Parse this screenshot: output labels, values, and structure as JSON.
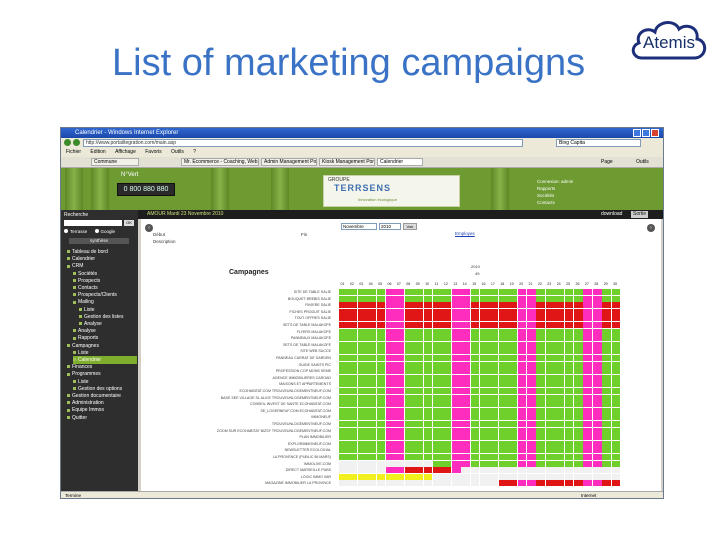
{
  "slide_title": "List of marketing campaigns",
  "logo_text": "Atemis",
  "browser": {
    "window_title": "Calendrier - Windows Internet Explorer",
    "url": "http://www.portailtegration.com/main.asp",
    "search_text": "Bing Capita",
    "menu": [
      "Fichier",
      "Edition",
      "Affichage",
      "Favoris",
      "Outils",
      "?"
    ],
    "tabs": [
      "Commune",
      "Mr. Ecommerce - Coaching, Web...",
      "Admin Management Portal",
      "Kiosk Management Portal",
      "Calendrier"
    ],
    "right_menu": [
      "Page",
      "Outils"
    ],
    "status_left": "Termine",
    "status_right": "Internet"
  },
  "app": {
    "nvert": "N°Vert",
    "phone": "0 800 880 880",
    "brand_groupe": "GROUPE",
    "brand_name": "TERRSENS",
    "brand_tagline": "Innovation écologique",
    "header_info": "Connexion: admin\nRapports\nSociétés\nContacts",
    "user_bar": "AMOUR  Mardi 23 Novembre 2010",
    "download_label": "download",
    "exit_label": "Sortie"
  },
  "sidebar": {
    "search_title": "Recherche",
    "go_label": "OK",
    "radio_labels": [
      "Terrasse",
      "Google"
    ],
    "select_value": "synthèse",
    "items": [
      {
        "label": "Tableau de bord",
        "level": 0
      },
      {
        "label": "Calendrier",
        "level": 0
      },
      {
        "label": "CRM",
        "level": 0
      },
      {
        "label": "Sociétés",
        "level": 1
      },
      {
        "label": "Prospects",
        "level": 1
      },
      {
        "label": "Contacts",
        "level": 1
      },
      {
        "label": "Prospects/Clients",
        "level": 1
      },
      {
        "label": "Mailing",
        "level": 1
      },
      {
        "label": "Liste",
        "level": 2
      },
      {
        "label": "Gestion des listes",
        "level": 2
      },
      {
        "label": "Analyse",
        "level": 2
      },
      {
        "label": "Analyse",
        "level": 1
      },
      {
        "label": "Rapports",
        "level": 1
      },
      {
        "label": "Campagnes",
        "level": 0
      },
      {
        "label": "Liste",
        "level": 1
      },
      {
        "label": "Calendrier",
        "level": 1,
        "active": true
      },
      {
        "label": "Finances",
        "level": 0
      },
      {
        "label": "Programmes",
        "level": 0
      },
      {
        "label": "Liste",
        "level": 1
      },
      {
        "label": "Gestion des options",
        "level": 1
      },
      {
        "label": "Gestion documentaire",
        "level": 0
      },
      {
        "label": "Administration",
        "level": 0
      },
      {
        "label": "Equipe Immos",
        "level": 0
      },
      {
        "label": "Quitter",
        "level": 0
      }
    ]
  },
  "content": {
    "debut_label": "Début",
    "fin_label": "Fin",
    "description_label": "Description",
    "month_select": "Novembre",
    "year_select": "2010",
    "valid_label": "Voir",
    "link_label": "Employes",
    "campaigns_title": "Campagnes",
    "year_label": "2010",
    "week_label": "49",
    "days": [
      "01",
      "02",
      "03",
      "04",
      "05",
      "06",
      "07",
      "08",
      "09",
      "10",
      "11",
      "12",
      "13",
      "14",
      "15",
      "16",
      "17",
      "18",
      "19",
      "20",
      "21",
      "22",
      "23",
      "24",
      "25",
      "26",
      "27",
      "28",
      "29",
      "30"
    ],
    "campaigns": [
      "SITE DE TABLE SALIE",
      "BOUQUET BREBIS SALIE",
      "RIVIERE SALIE",
      "FICHES PRODUIT SALIE",
      "TOUT OFFRES SALIE",
      "SETS DE TABLE MALAKOFE",
      "FLYERS MALAKOFE",
      "PANNEAUX MALAKOFE",
      "SETS DE TABLE MALAKOFE",
      "SITE WEB SUCCE",
      "PANNEAU CARRAT DE GARDEN",
      "GUIDE SAINTS PIC",
      "PROFESSION COP MONS SEME",
      "AGENCE IMMOBILIERES CAROAD",
      "MAISONS ET APPARTEMENTS",
      "ECOHABITAT.COM TROUVEUNLOGEMENTNEUF.COM",
      "BASE SEE VILLAGE SL ALICE TROUVEUNLOGEMENTNEUF.COM",
      "CONSEIL INVEST DE SANTE ECOHABITAT.COM",
      "SE_LOGERNEUF.COM ECOHABITAT.COM",
      "IMMONEUF",
      "TROUVEUNLOGEMENTNEUF.COM",
      "ZOOM SUR ECOHABITAT BIZSY TROUVEUNLOGEMENTNEUF.COM",
      "PLAN IMMOBILIER",
      "EXPLORIMMONEUF.COM",
      "NEWSLETTER ECOLOGIAL",
      "LA PROVENCE (PUBLIC 56 MARS)",
      "IMMOLIVE.COM",
      "DIRECT MARSEILLE PUBS",
      "LOGIC IMMO VAR",
      "MAGAZINE IMMOBILIER LA PROVINCE"
    ],
    "schedule": [
      {
        "base": "#6fd02b",
        "wknd": "#ff2dbd",
        "from": 0,
        "to": 29
      },
      {
        "base": "#6fd02b",
        "wknd": "#ff2dbd",
        "from": 0,
        "to": 29
      },
      {
        "base": "#e01616",
        "wknd": "#ff2dbd",
        "from": 0,
        "to": 29
      },
      {
        "base": "#e01616",
        "wknd": "#ff2dbd",
        "from": 0,
        "to": 29
      },
      {
        "base": "#e01616",
        "wknd": "#ff2dbd",
        "from": 0,
        "to": 29
      },
      {
        "base": "#e01616",
        "wknd": "#ff2dbd",
        "from": 0,
        "to": 29
      },
      {
        "base": "#6fd02b",
        "wknd": "#ff2dbd",
        "from": 0,
        "to": 29
      },
      {
        "base": "#6fd02b",
        "wknd": "#ff2dbd",
        "from": 0,
        "to": 29
      },
      {
        "base": "#6fd02b",
        "wknd": "#ff2dbd",
        "from": 0,
        "to": 29
      },
      {
        "base": "#6fd02b",
        "wknd": "#ff2dbd",
        "from": 0,
        "to": 29
      },
      {
        "base": "#6fd02b",
        "wknd": "#ff2dbd",
        "from": 0,
        "to": 29
      },
      {
        "base": "#6fd02b",
        "wknd": "#ff2dbd",
        "from": 0,
        "to": 29
      },
      {
        "base": "#6fd02b",
        "wknd": "#ff2dbd",
        "from": 0,
        "to": 29
      },
      {
        "base": "#6fd02b",
        "wknd": "#ff2dbd",
        "from": 0,
        "to": 29
      },
      {
        "base": "#6fd02b",
        "wknd": "#ff2dbd",
        "from": 0,
        "to": 29
      },
      {
        "base": "#6fd02b",
        "wknd": "#ff2dbd",
        "from": 0,
        "to": 29
      },
      {
        "base": "#6fd02b",
        "wknd": "#ff2dbd",
        "from": 0,
        "to": 29
      },
      {
        "base": "#6fd02b",
        "wknd": "#ff2dbd",
        "from": 0,
        "to": 29
      },
      {
        "base": "#6fd02b",
        "wknd": "#ff2dbd",
        "from": 0,
        "to": 29
      },
      {
        "base": "#6fd02b",
        "wknd": "#ff2dbd",
        "from": 0,
        "to": 29
      },
      {
        "base": "#6fd02b",
        "wknd": "#ff2dbd",
        "from": 0,
        "to": 29
      },
      {
        "base": "#6fd02b",
        "wknd": "#ff2dbd",
        "from": 0,
        "to": 29
      },
      {
        "base": "#6fd02b",
        "wknd": "#ff2dbd",
        "from": 0,
        "to": 29
      },
      {
        "base": "#6fd02b",
        "wknd": "#ff2dbd",
        "from": 0,
        "to": 29
      },
      {
        "base": "#6fd02b",
        "wknd": "#ff2dbd",
        "from": 0,
        "to": 29
      },
      {
        "base": "#6fd02b",
        "wknd": "#ff2dbd",
        "from": 0,
        "to": 29
      },
      {
        "base": "#6fd02b",
        "wknd": "#ff2dbd",
        "from": 10,
        "to": 29
      },
      {
        "base": "#e01616",
        "wknd": "#ff2dbd",
        "from": 5,
        "to": 12
      },
      {
        "base": "#f2ef1f",
        "wknd": "#f2ef1f",
        "from": 0,
        "to": 9
      },
      {
        "base": "#e01616",
        "wknd": "#ff2dbd",
        "from": 17,
        "to": 29
      }
    ],
    "weekend_columns": [
      5,
      6,
      12,
      13,
      19,
      20,
      26,
      27
    ]
  },
  "colors": {
    "title": "#3a73c6",
    "header_green": "#6e9a32",
    "nav_active": "#7fae2e",
    "campaign_green": "#6fd02b",
    "campaign_red": "#e01616",
    "campaign_magenta": "#ff2dbd",
    "campaign_yellow": "#f2ef1f"
  }
}
